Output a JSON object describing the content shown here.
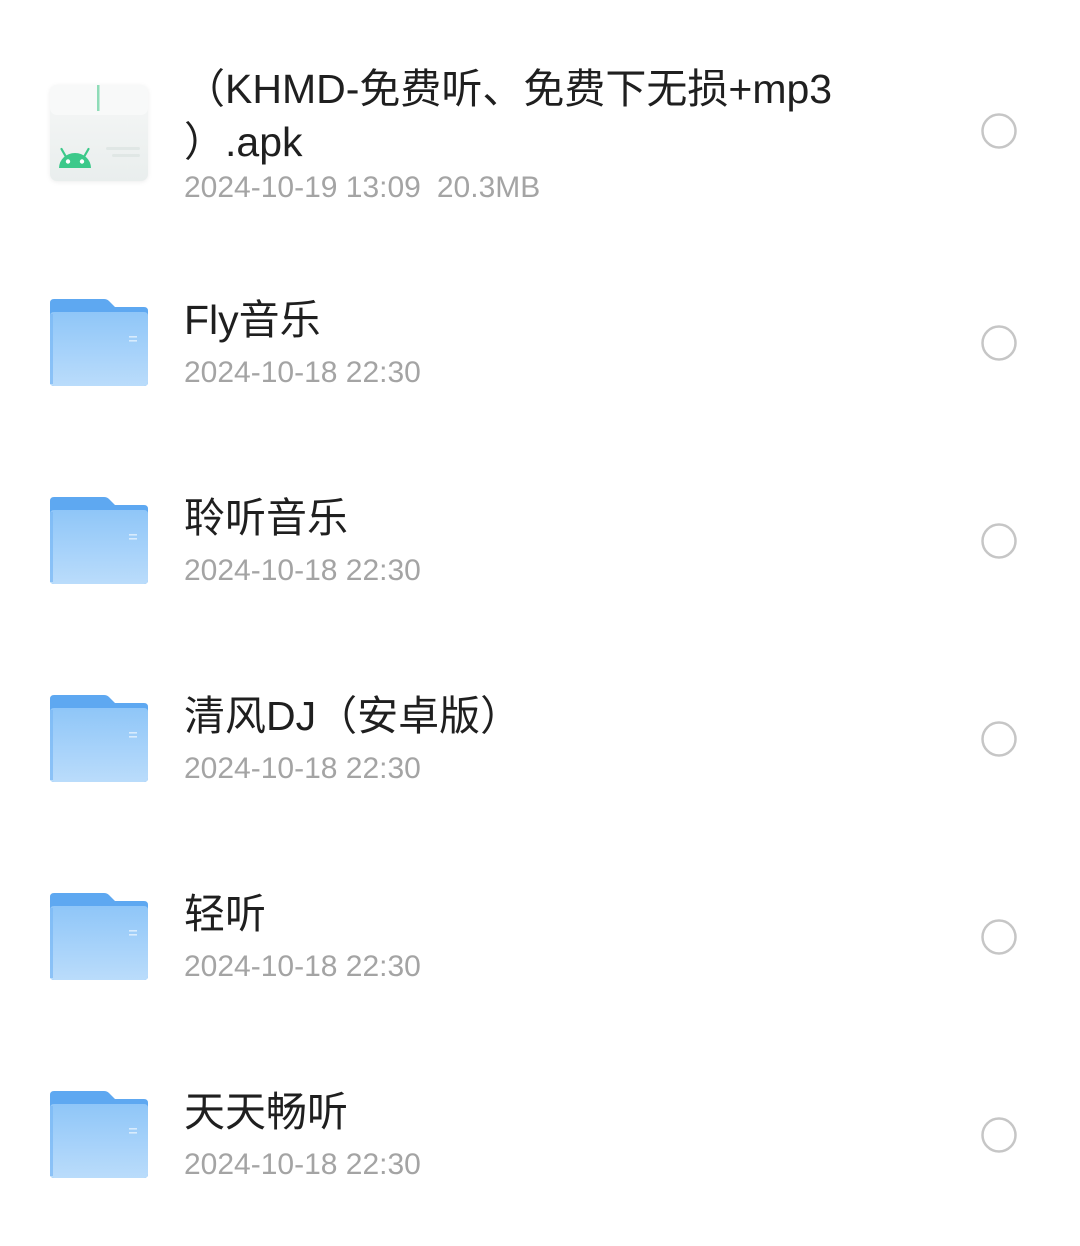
{
  "files": [
    {
      "type": "apk",
      "icon": "apk-file-icon",
      "name_lines": [
        "（KHMD-免费听、免费下无损+mp3",
        "）.apk"
      ],
      "date": "2024-10-19 13:09",
      "size": "20.3MB",
      "selected": false
    },
    {
      "type": "folder",
      "icon": "folder-icon",
      "name": "Fly音乐",
      "date": "2024-10-18 22:30",
      "selected": false
    },
    {
      "type": "folder",
      "icon": "folder-icon",
      "name": "聆听音乐",
      "date": "2024-10-18 22:30",
      "selected": false
    },
    {
      "type": "folder",
      "icon": "folder-icon",
      "name": "清风DJ（安卓版）",
      "date": "2024-10-18 22:30",
      "selected": false
    },
    {
      "type": "folder",
      "icon": "folder-icon",
      "name": "轻听",
      "date": "2024-10-18 22:30",
      "selected": false
    },
    {
      "type": "folder",
      "icon": "folder-icon",
      "name": "天天畅听",
      "date": "2024-10-18 22:30",
      "selected": false
    }
  ],
  "colors": {
    "text_primary": "#1f1f1f",
    "text_secondary": "#a4a4a4",
    "folder_blue": "#5ea8f1",
    "android_green": "#3cc98a",
    "radio_stroke": "#c6c6c6"
  }
}
